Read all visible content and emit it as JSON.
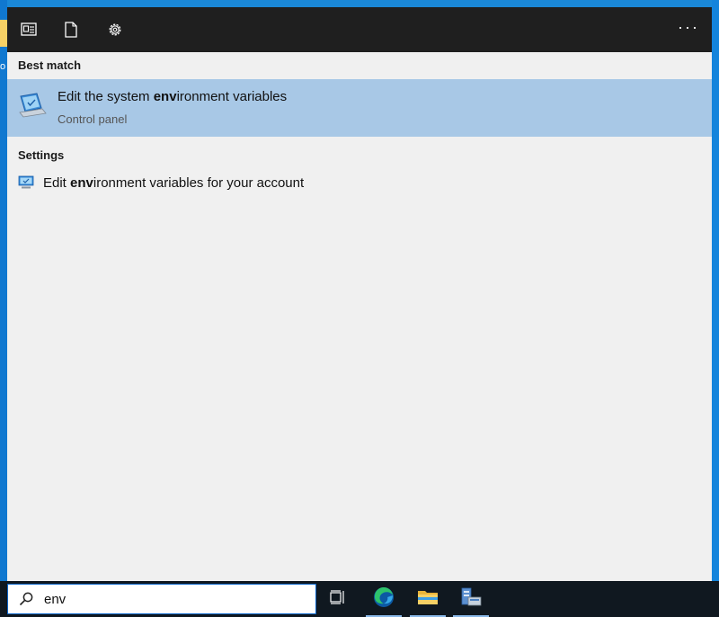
{
  "desktop": {
    "edge_text": "o"
  },
  "topbar": {
    "apps_icon": "apps-view-icon",
    "documents_icon": "document-icon",
    "settings_icon": "gear-icon",
    "more_label": "···"
  },
  "best_match": {
    "heading": "Best match",
    "item": {
      "title_prefix": "Edit the system ",
      "title_bold": "env",
      "title_suffix": "ironment variables",
      "subtitle": "Control panel",
      "icon": "system-properties-icon"
    }
  },
  "settings": {
    "heading": "Settings",
    "item": {
      "title_prefix": "Edit ",
      "title_bold": "env",
      "title_suffix": "ironment variables for your account",
      "icon": "settings-monitor-icon"
    }
  },
  "taskbar": {
    "search_value": "env",
    "search_icon": "search-icon",
    "apps": [
      {
        "name": "task-view",
        "icon": "task-view-icon",
        "active": false
      },
      {
        "name": "edge",
        "icon": "edge-icon",
        "active": true
      },
      {
        "name": "file-explorer",
        "icon": "folder-icon",
        "active": true
      },
      {
        "name": "server-manager",
        "icon": "server-manager-icon",
        "active": true
      }
    ]
  },
  "colors": {
    "selected_row": "#a8c8e6",
    "topbar": "#1f1f1f",
    "taskbar": "#101820",
    "desktop": "#1a88d8"
  }
}
